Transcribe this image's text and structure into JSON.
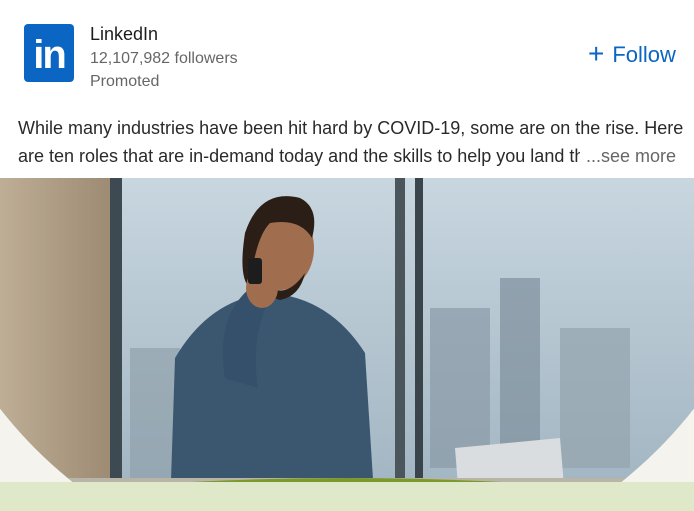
{
  "company": {
    "name": "LinkedIn",
    "followers": "12,107,982 followers",
    "promoted": "Promoted",
    "logo_text": "in"
  },
  "follow": {
    "label": "Follow",
    "icon": "plus-icon"
  },
  "post": {
    "line1": "While many industries have been hit hard by COVID-19, some are on the rise. Here",
    "line2": "are ten roles that are in-demand today and the skills to help you land th",
    "see_more": "...see more"
  },
  "image": {
    "subject": "man-on-phone-with-laptop"
  },
  "colors": {
    "brand": "#0a66c2",
    "accent_green": "#7a9a2e",
    "strip": "#dfe9c9"
  }
}
